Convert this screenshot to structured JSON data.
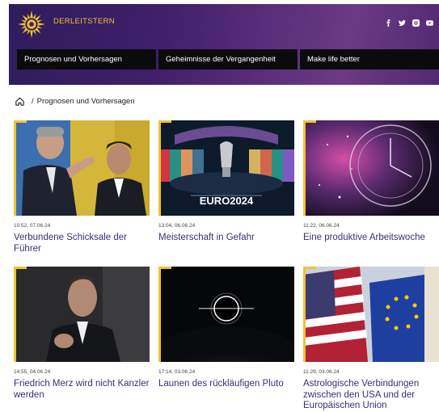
{
  "header": {
    "brand": "DERLEITSTERN",
    "social": [
      "facebook-icon",
      "twitter-icon",
      "instagram-icon",
      "youtube-icon"
    ],
    "nav": [
      "Prognosen und Vorhersagen",
      "Geheimnisse der Vergangenheit",
      "Make life better"
    ]
  },
  "breadcrumb": {
    "separator": "/",
    "current": "Prognosen und Vorhersagen"
  },
  "colors": {
    "accent": "#f1c232",
    "title": "#3f2c7a",
    "nav_bg": "#0b0b0d"
  },
  "articles": [
    {
      "meta": "10:52, 07.06.24",
      "title": "Verbundene Schicksale der Führer",
      "image": "two-politicians-photo"
    },
    {
      "meta": "13:04, 06.06.24",
      "title": "Meisterschaft in Gefahr",
      "image": "euro2024-trophy-photo",
      "image_text": "EURO2024"
    },
    {
      "meta": "11:22, 06.06.24",
      "title": "Eine produktive Arbeitswoche",
      "image": "zodiac-clock-photo"
    },
    {
      "meta": "14:55, 04.06.24",
      "title": "Friedrich Merz wird nicht Kanzler werden",
      "image": "politician-portrait-photo"
    },
    {
      "meta": "17:14, 03.06.24",
      "title": "Launen des rückläufigen Pluto",
      "image": "eclipse-planet-photo"
    },
    {
      "meta": "11:29, 03.06.24",
      "title": "Astrologische Verbindungen zwischen den USA und der Europäischen Union",
      "image": "us-eu-flags-photo"
    }
  ]
}
